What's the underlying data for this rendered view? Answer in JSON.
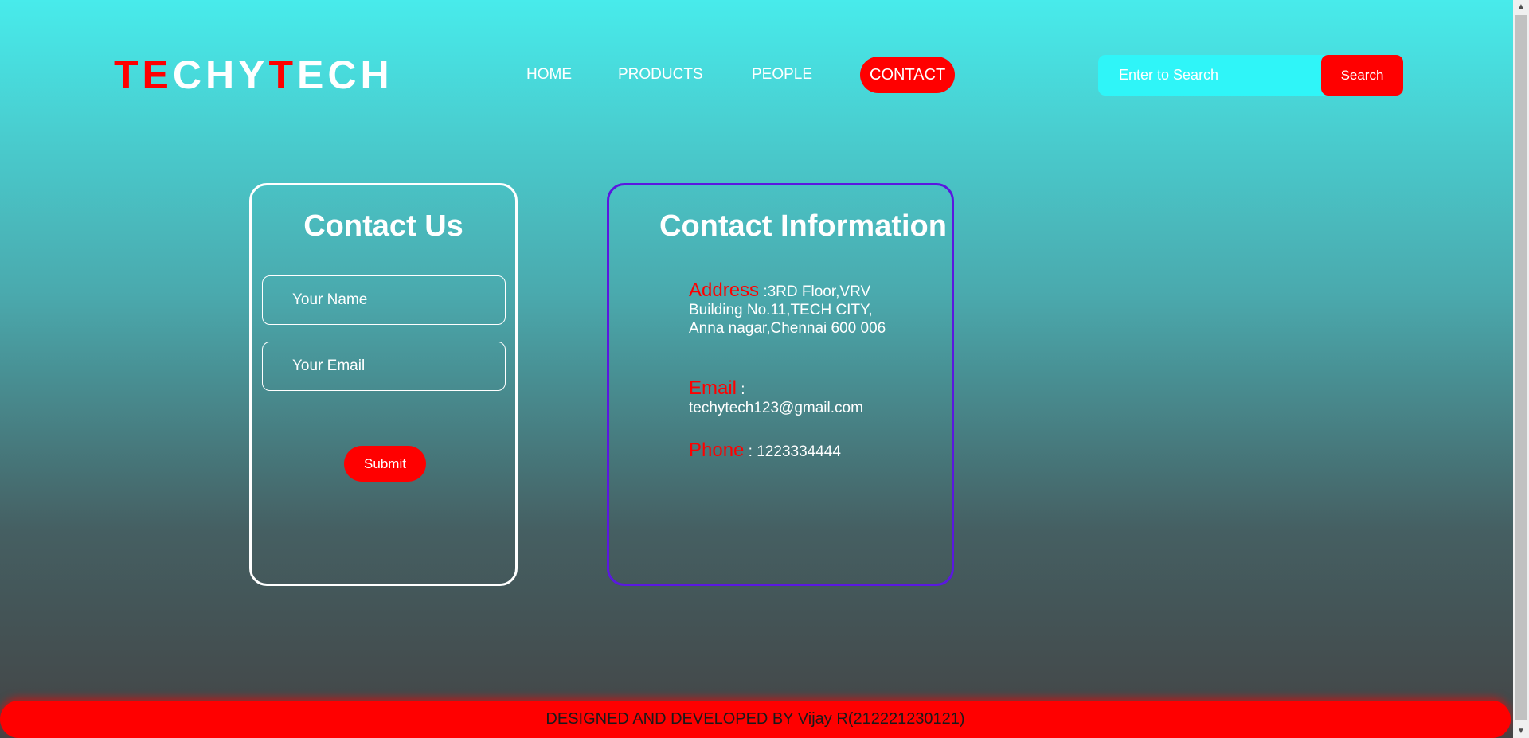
{
  "logo": {
    "parts": [
      "T",
      "E",
      "CHY",
      "T",
      "ECH"
    ]
  },
  "nav": {
    "items": [
      {
        "label": "HOME"
      },
      {
        "label": "PRODUCTS"
      },
      {
        "label": "PEOPLE"
      },
      {
        "label": "CONTACT",
        "active": true
      }
    ]
  },
  "search": {
    "placeholder": "Enter to Search",
    "button_label": "Search"
  },
  "contact_form": {
    "title": "Contact Us",
    "name_placeholder": "Your Name",
    "email_placeholder": "Your Email",
    "submit_label": "Submit"
  },
  "contact_info": {
    "title": "Contact Information",
    "address_label": "Address",
    "address_value": " :3RD Floor,VRV Building No.11,TECH CITY, Anna nagar,Chennai 600 006",
    "email_label": "Email",
    "email_value": " : techytech123@gmail.com",
    "phone_label": "Phone",
    "phone_value": " : 1223334444"
  },
  "footer": {
    "text": "DESIGNED AND DEVELOPED BY Vijay R(212221230121)"
  },
  "colors": {
    "accent": "#ff0000",
    "info_border": "#5a18e0",
    "search_bg": "#2ff5f8"
  }
}
